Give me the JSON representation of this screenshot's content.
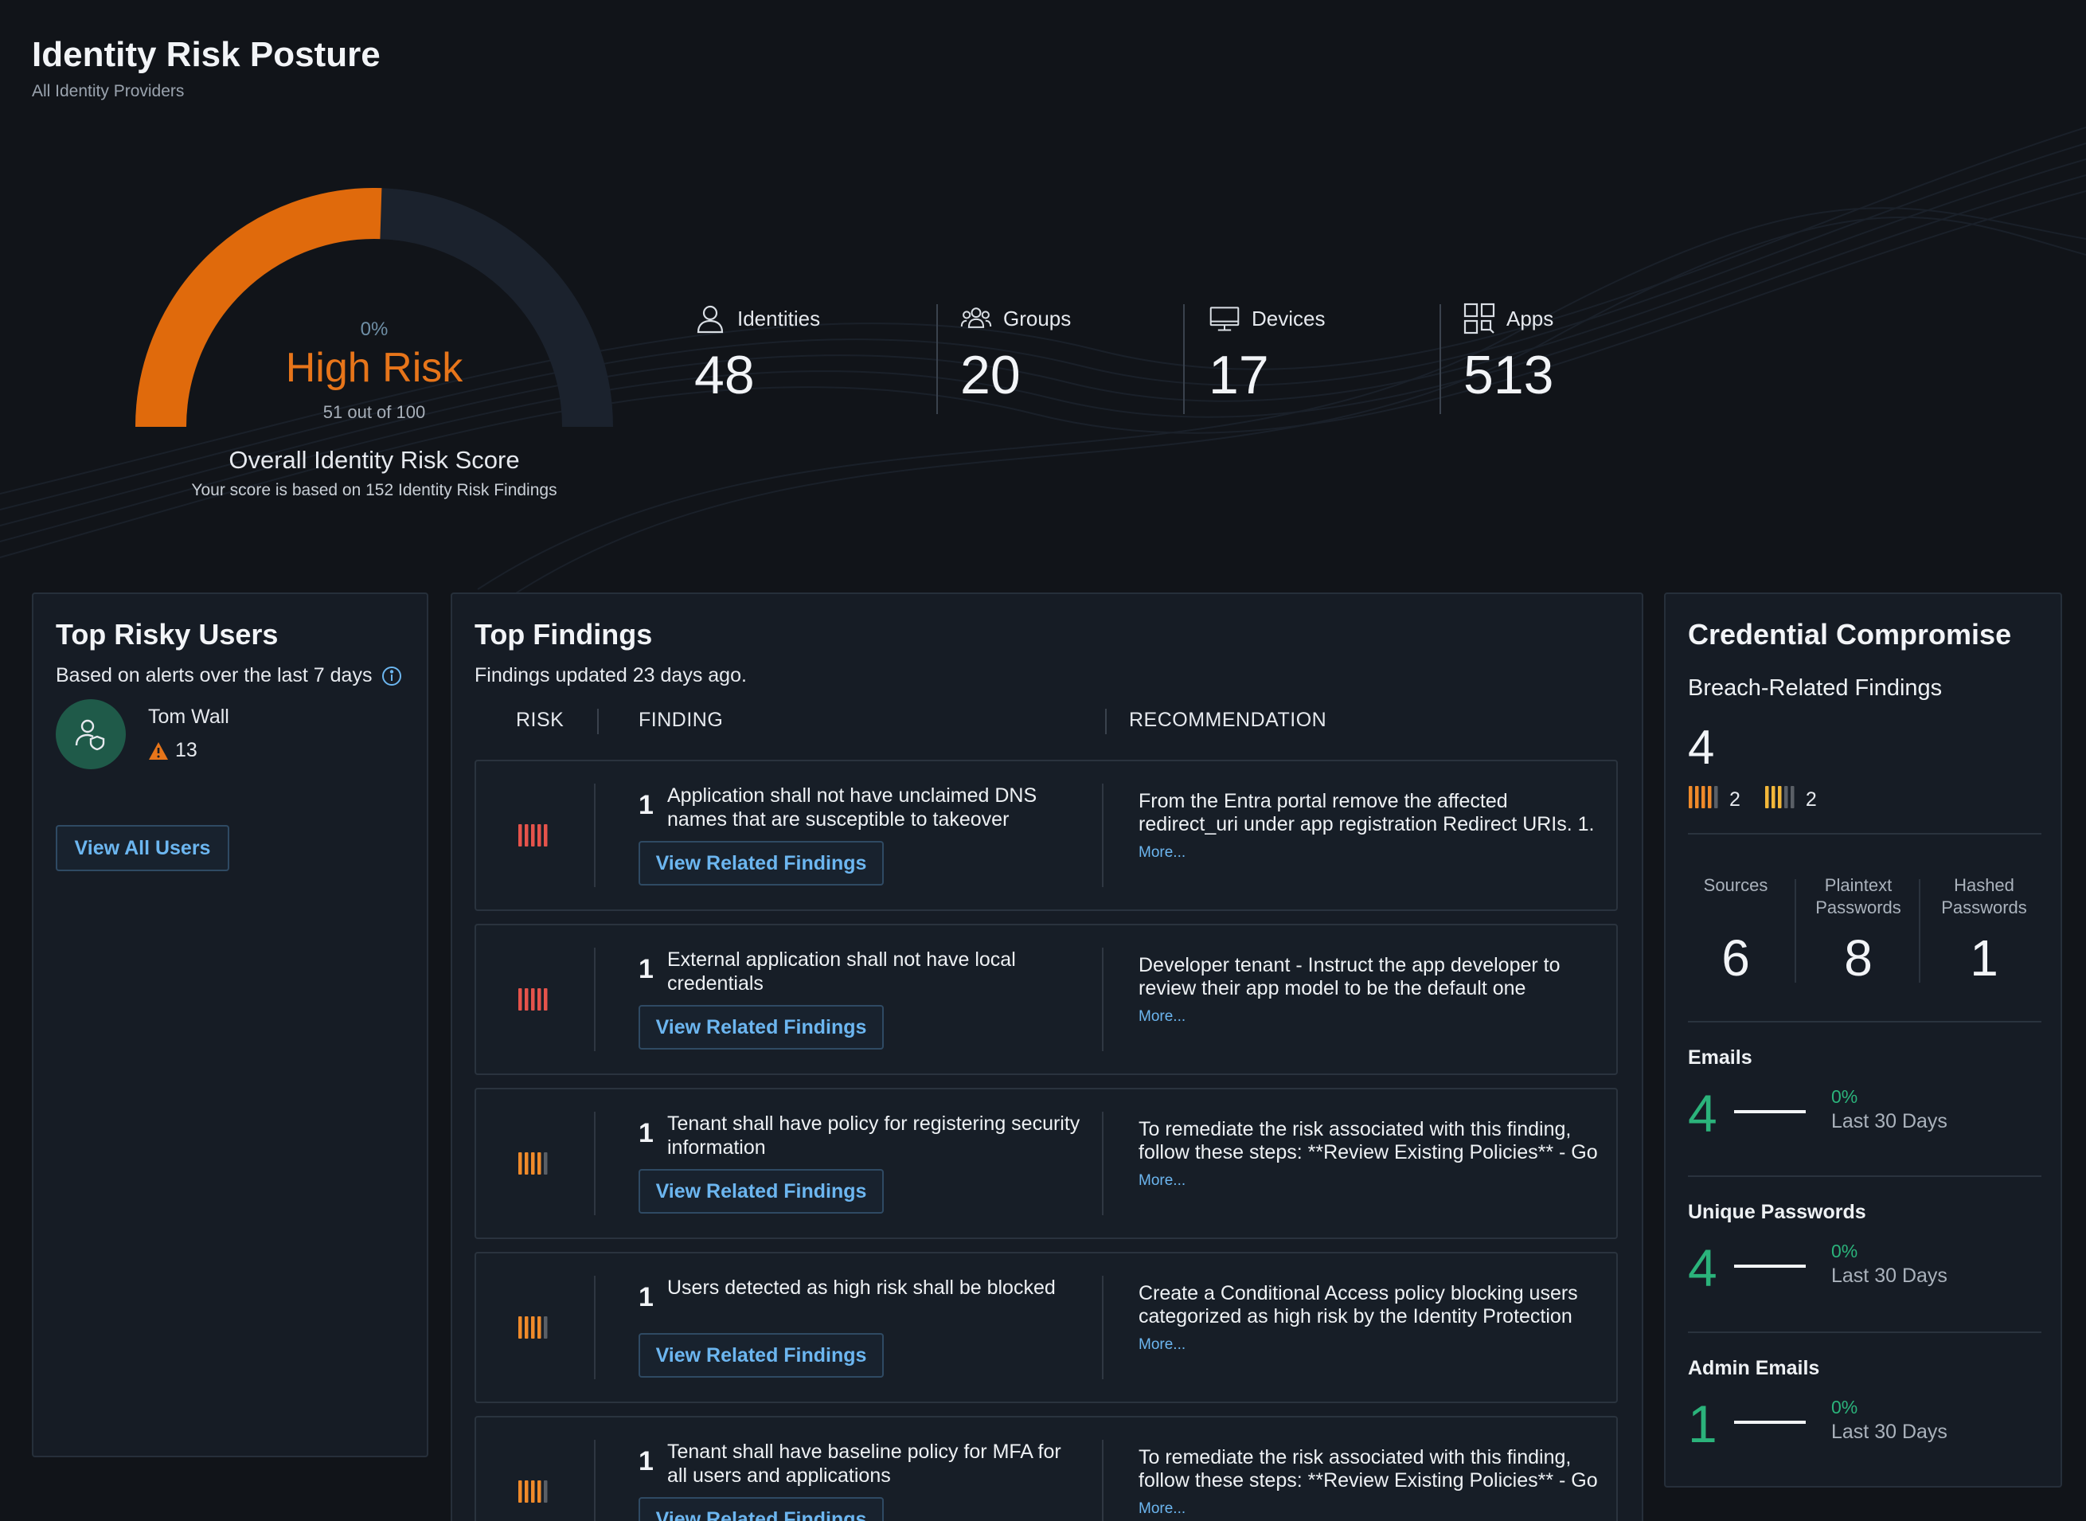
{
  "header": {
    "title": "Identity Risk Posture",
    "subtitle": "All Identity Providers"
  },
  "score": {
    "percent_label": "0%",
    "risk_label": "High Risk",
    "score_text": "51 out of 100",
    "value": 51,
    "max": 100,
    "title": "Overall Identity Risk Score",
    "subtitle": "Your score is based on 152 Identity Risk Findings",
    "colors": {
      "fill": "#e06a0c",
      "track": "#1b222d"
    }
  },
  "stats": [
    {
      "label": "Identities",
      "value": "48",
      "icon": "user-icon"
    },
    {
      "label": "Groups",
      "value": "20",
      "icon": "group-icon"
    },
    {
      "label": "Devices",
      "value": "17",
      "icon": "monitor-icon"
    },
    {
      "label": "Apps",
      "value": "513",
      "icon": "apps-grid-icon"
    }
  ],
  "risky_users": {
    "title": "Top Risky Users",
    "basis": "Based on alerts over the last 7 days",
    "users": [
      {
        "name": "Tom Wall",
        "alerts": "13"
      }
    ],
    "view_all_label": "View All Users"
  },
  "findings": {
    "title": "Top Findings",
    "updated": "Findings updated 23 days ago.",
    "columns": {
      "risk": "RISK",
      "finding": "FINDING",
      "recommendation": "RECOMMENDATION"
    },
    "button_label": "View Related Findings",
    "more_label": "More...",
    "rows": [
      {
        "count": "1",
        "severity": "critical",
        "finding": "Application shall not have unclaimed DNS names that are susceptible to takeover",
        "recommendation": "From the Entra portal remove the affected redirect_uri under app registration Redirect URIs. 1."
      },
      {
        "count": "1",
        "severity": "critical",
        "finding": "External application shall not have local credentials",
        "recommendation": "Developer tenant - Instruct the app developer to review their app model to be the default one"
      },
      {
        "count": "1",
        "severity": "high",
        "finding": "Tenant shall have policy for registering security information",
        "recommendation": "To remediate the risk associated with this finding, follow these steps: **Review Existing Policies** - Go"
      },
      {
        "count": "1",
        "severity": "high",
        "finding": "Users detected as high risk shall be blocked",
        "recommendation": "Create a Conditional Access policy blocking users categorized as high risk by the Identity Protection"
      },
      {
        "count": "1",
        "severity": "high",
        "finding": "Tenant shall have baseline policy for MFA for all users and applications",
        "recommendation": "To remediate the risk associated with this finding, follow these steps: **Review Existing Policies** - Go"
      }
    ]
  },
  "credential": {
    "title": "Credential Compromise",
    "breach_title": "Breach-Related Findings",
    "breach_value": "4",
    "severity_counts": [
      {
        "severity": "high",
        "count": "2"
      },
      {
        "severity": "medium",
        "count": "2"
      }
    ],
    "sources": [
      {
        "label": "Sources",
        "value": "6"
      },
      {
        "label": "Plaintext Passwords",
        "value": "8"
      },
      {
        "label": "Hashed Passwords",
        "value": "1"
      }
    ],
    "metrics": [
      {
        "label": "Emails",
        "value": "4",
        "change": "0%",
        "period": "Last 30 Days"
      },
      {
        "label": "Unique Passwords",
        "value": "4",
        "change": "0%",
        "period": "Last 30 Days"
      },
      {
        "label": "Admin Emails",
        "value": "1",
        "change": "0%",
        "period": "Last 30 Days"
      }
    ]
  }
}
